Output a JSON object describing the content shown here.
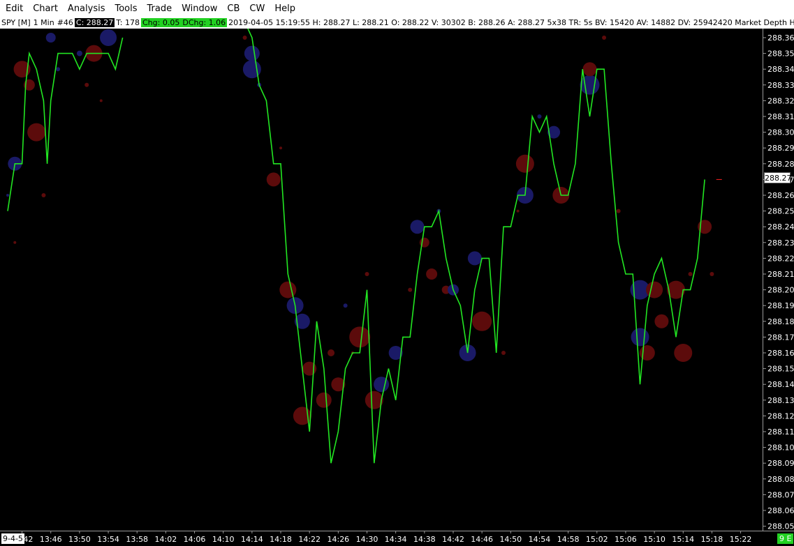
{
  "menu": [
    "Edit",
    "Chart",
    "Analysis",
    "Tools",
    "Trade",
    "Window",
    "CB",
    "CW",
    "Help"
  ],
  "info": {
    "symbol": "SPY [M]",
    "interval": "1 Min",
    "bar_no": "#46",
    "close": "C: 288.27",
    "ticks": "T: 178",
    "chg": "Chg: 0.05",
    "dchg": "DChg: 1.06",
    "rest": "2019-04-05 15:19:55 H: 288.27 L: 288.21 O: 288.22 V: 30302 B: 288.26 A: 288.27 5x38 TR: 5s BV: 15420 AV: 14882 DV: 25942420 Market Depth Historical Gr"
  },
  "current_price": "288.27",
  "date_tag": "9-4-5",
  "corner_tag": "9 E",
  "colors": {
    "line": "#22e622",
    "bid": "#1a1a66",
    "ask": "#5c0b0b",
    "grid_text": "#ffffff",
    "background": "#000000"
  },
  "chart_data": {
    "type": "line",
    "ylim": [
      288.045,
      288.37
    ],
    "yticks": [
      288.36,
      288.35,
      288.34,
      288.33,
      288.32,
      288.31,
      288.3,
      288.29,
      288.28,
      288.27,
      288.26,
      288.25,
      288.24,
      288.23,
      288.22,
      288.21,
      288.2,
      288.19,
      288.18,
      288.17,
      288.16,
      288.15,
      288.14,
      288.13,
      288.12,
      288.11,
      288.1,
      288.09,
      288.08,
      288.07,
      288.06,
      288.05
    ],
    "xticks": [
      "13:42",
      "13:46",
      "13:50",
      "13:54",
      "13:58",
      "14:02",
      "14:06",
      "14:10",
      "14:14",
      "14:18",
      "14:22",
      "14:26",
      "14:30",
      "14:34",
      "14:38",
      "14:42",
      "14:46",
      "14:50",
      "14:54",
      "14:58",
      "15:02",
      "15:06",
      "15:10",
      "15:14",
      "15:18",
      "15:22"
    ],
    "x_start": "13:40",
    "x_end": "15:22",
    "segments": [
      {
        "x": [
          "13:40",
          "13:41",
          "13:42",
          "13:42.5",
          "13:43",
          "13:44",
          "13:45",
          "13:45.5",
          "13:46",
          "13:47",
          "13:48",
          "13:49",
          "13:50",
          "13:51",
          "13:52",
          "13:53",
          "13:54",
          "13:55",
          "13:56"
        ],
        "y": [
          288.25,
          288.28,
          288.28,
          288.33,
          288.35,
          288.34,
          288.32,
          288.28,
          288.32,
          288.35,
          288.35,
          288.35,
          288.34,
          288.35,
          288.35,
          288.35,
          288.35,
          288.34,
          288.36
        ]
      },
      {
        "x": [
          "14:13",
          "14:14",
          "14:15",
          "14:16",
          "14:17",
          "14:18",
          "14:19",
          "14:20",
          "14:21",
          "14:22",
          "14:23",
          "14:24",
          "14:25",
          "14:26",
          "14:27",
          "14:28",
          "14:29",
          "14:30",
          "14:31",
          "14:32",
          "14:33",
          "14:34",
          "14:35",
          "14:36",
          "14:37",
          "14:38",
          "14:39",
          "14:40",
          "14:41",
          "14:42",
          "14:43",
          "14:44",
          "14:45",
          "14:46",
          "14:47",
          "14:48",
          "14:49",
          "14:50",
          "14:51",
          "14:52",
          "14:53",
          "14:54",
          "14:55",
          "14:56",
          "14:57",
          "14:58",
          "14:59",
          "15:00",
          "15:01",
          "15:02",
          "15:03",
          "15:04",
          "15:05",
          "15:06",
          "15:07",
          "15:08",
          "15:09",
          "15:10",
          "15:11",
          "15:12",
          "15:13",
          "15:14",
          "15:15",
          "15:16",
          "15:17",
          "15:18",
          "15:19"
        ],
        "y": [
          288.37,
          288.36,
          288.33,
          288.32,
          288.28,
          288.28,
          288.21,
          288.19,
          288.15,
          288.11,
          288.18,
          288.15,
          288.09,
          288.11,
          288.15,
          288.16,
          288.16,
          288.2,
          288.09,
          288.13,
          288.15,
          288.13,
          288.17,
          288.17,
          288.21,
          288.24,
          288.24,
          288.25,
          288.22,
          288.2,
          288.19,
          288.16,
          288.2,
          288.22,
          288.22,
          288.16,
          288.24,
          288.24,
          288.26,
          288.26,
          288.31,
          288.3,
          288.31,
          288.28,
          288.26,
          288.26,
          288.28,
          288.34,
          288.31,
          288.34,
          288.34,
          288.28,
          288.23,
          288.21,
          288.21,
          288.14,
          288.19,
          288.21,
          288.22,
          288.2,
          288.17,
          288.2,
          288.2,
          288.22,
          288.27
        ]
      }
    ],
    "bubbles": [
      {
        "t": "13:40",
        "p": 288.26,
        "s": 2,
        "side": "bid"
      },
      {
        "t": "13:41",
        "p": 288.23,
        "s": 2,
        "side": "ask"
      },
      {
        "t": "13:41",
        "p": 288.28,
        "s": 10,
        "side": "bid"
      },
      {
        "t": "13:42",
        "p": 288.34,
        "s": 12,
        "side": "ask"
      },
      {
        "t": "13:43",
        "p": 288.33,
        "s": 8,
        "side": "ask"
      },
      {
        "t": "13:44",
        "p": 288.3,
        "s": 13,
        "side": "ask"
      },
      {
        "t": "13:45",
        "p": 288.26,
        "s": 3,
        "side": "ask"
      },
      {
        "t": "13:46",
        "p": 288.36,
        "s": 7,
        "side": "bid"
      },
      {
        "t": "13:47",
        "p": 288.34,
        "s": 3,
        "side": "bid"
      },
      {
        "t": "13:50",
        "p": 288.35,
        "s": 4,
        "side": "bid"
      },
      {
        "t": "13:51",
        "p": 288.33,
        "s": 3,
        "side": "ask"
      },
      {
        "t": "13:52",
        "p": 288.35,
        "s": 12,
        "side": "ask"
      },
      {
        "t": "13:54",
        "p": 288.36,
        "s": 12,
        "side": "bid"
      },
      {
        "t": "13:53",
        "p": 288.32,
        "s": 2,
        "side": "ask"
      },
      {
        "t": "14:13",
        "p": 288.36,
        "s": 3,
        "side": "ask"
      },
      {
        "t": "14:14",
        "p": 288.35,
        "s": 11,
        "side": "bid"
      },
      {
        "t": "14:14",
        "p": 288.34,
        "s": 13,
        "side": "bid"
      },
      {
        "t": "14:15",
        "p": 288.33,
        "s": 3,
        "side": "bid"
      },
      {
        "t": "14:17",
        "p": 288.27,
        "s": 10,
        "side": "ask"
      },
      {
        "t": "14:18",
        "p": 288.29,
        "s": 2,
        "side": "ask"
      },
      {
        "t": "14:19",
        "p": 288.2,
        "s": 12,
        "side": "ask"
      },
      {
        "t": "14:20",
        "p": 288.19,
        "s": 12,
        "side": "bid"
      },
      {
        "t": "14:21",
        "p": 288.18,
        "s": 11,
        "side": "bid"
      },
      {
        "t": "14:21",
        "p": 288.12,
        "s": 13,
        "side": "ask"
      },
      {
        "t": "14:22",
        "p": 288.15,
        "s": 10,
        "side": "ask"
      },
      {
        "t": "14:24",
        "p": 288.13,
        "s": 11,
        "side": "ask"
      },
      {
        "t": "14:25",
        "p": 288.16,
        "s": 5,
        "side": "ask"
      },
      {
        "t": "14:26",
        "p": 288.14,
        "s": 10,
        "side": "ask"
      },
      {
        "t": "14:27",
        "p": 288.19,
        "s": 3,
        "side": "bid"
      },
      {
        "t": "14:28",
        "p": 288.16,
        "s": 2,
        "side": "ask"
      },
      {
        "t": "14:29",
        "p": 288.17,
        "s": 15,
        "side": "ask"
      },
      {
        "t": "14:30",
        "p": 288.21,
        "s": 3,
        "side": "ask"
      },
      {
        "t": "14:31",
        "p": 288.13,
        "s": 13,
        "side": "ask"
      },
      {
        "t": "14:32",
        "p": 288.14,
        "s": 11,
        "side": "bid"
      },
      {
        "t": "14:34",
        "p": 288.16,
        "s": 10,
        "side": "bid"
      },
      {
        "t": "14:36",
        "p": 288.2,
        "s": 3,
        "side": "ask"
      },
      {
        "t": "14:37",
        "p": 288.24,
        "s": 10,
        "side": "bid"
      },
      {
        "t": "14:38",
        "p": 288.23,
        "s": 7,
        "side": "ask"
      },
      {
        "t": "14:39",
        "p": 288.21,
        "s": 8,
        "side": "ask"
      },
      {
        "t": "14:40",
        "p": 288.25,
        "s": 3,
        "side": "bid"
      },
      {
        "t": "14:41",
        "p": 288.2,
        "s": 6,
        "side": "ask"
      },
      {
        "t": "14:42",
        "p": 288.2,
        "s": 8,
        "side": "bid"
      },
      {
        "t": "14:44",
        "p": 288.16,
        "s": 12,
        "side": "bid"
      },
      {
        "t": "14:45",
        "p": 288.22,
        "s": 10,
        "side": "bid"
      },
      {
        "t": "14:46",
        "p": 288.18,
        "s": 14,
        "side": "ask"
      },
      {
        "t": "14:49",
        "p": 288.16,
        "s": 3,
        "side": "ask"
      },
      {
        "t": "14:51",
        "p": 288.25,
        "s": 2,
        "side": "ask"
      },
      {
        "t": "14:52",
        "p": 288.28,
        "s": 13,
        "side": "ask"
      },
      {
        "t": "14:52",
        "p": 288.26,
        "s": 12,
        "side": "bid"
      },
      {
        "t": "14:54",
        "p": 288.31,
        "s": 3,
        "side": "bid"
      },
      {
        "t": "14:56",
        "p": 288.3,
        "s": 9,
        "side": "bid"
      },
      {
        "t": "14:57",
        "p": 288.26,
        "s": 12,
        "side": "ask"
      },
      {
        "t": "15:01",
        "p": 288.33,
        "s": 14,
        "side": "bid"
      },
      {
        "t": "15:01",
        "p": 288.34,
        "s": 10,
        "side": "ask"
      },
      {
        "t": "15:03",
        "p": 288.36,
        "s": 3,
        "side": "ask"
      },
      {
        "t": "15:05",
        "p": 288.25,
        "s": 3,
        "side": "ask"
      },
      {
        "t": "15:08",
        "p": 288.2,
        "s": 14,
        "side": "bid"
      },
      {
        "t": "15:08",
        "p": 288.17,
        "s": 13,
        "side": "bid"
      },
      {
        "t": "15:09",
        "p": 288.16,
        "s": 11,
        "side": "ask"
      },
      {
        "t": "15:10",
        "p": 288.2,
        "s": 12,
        "side": "ask"
      },
      {
        "t": "15:11",
        "p": 288.18,
        "s": 10,
        "side": "ask"
      },
      {
        "t": "15:13",
        "p": 288.2,
        "s": 13,
        "side": "ask"
      },
      {
        "t": "15:14",
        "p": 288.16,
        "s": 13,
        "side": "ask"
      },
      {
        "t": "15:15",
        "p": 288.21,
        "s": 3,
        "side": "ask"
      },
      {
        "t": "15:17",
        "p": 288.24,
        "s": 10,
        "side": "ask"
      },
      {
        "t": "15:18",
        "p": 288.21,
        "s": 3,
        "side": "ask"
      }
    ]
  }
}
